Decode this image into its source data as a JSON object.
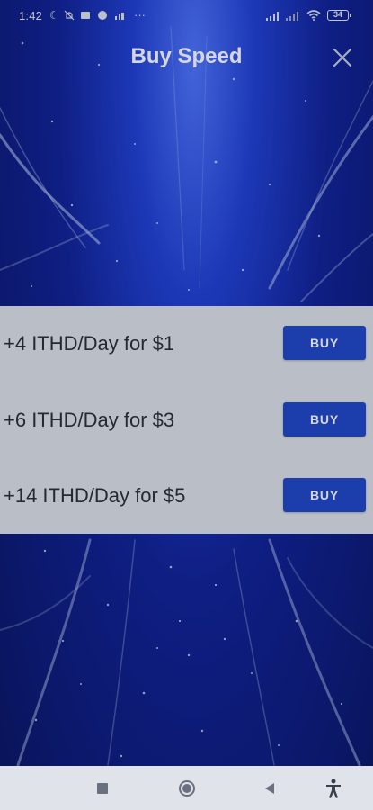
{
  "status_bar": {
    "time": "1:42",
    "more_dots": "···",
    "battery": "34",
    "icons": [
      "moon-icon",
      "mute-icon",
      "notification-icon",
      "app-icon",
      "network-icon",
      "signal-icon",
      "wifi-icon",
      "battery-icon"
    ]
  },
  "header": {
    "title": "Buy Speed",
    "close_icon": "close-icon"
  },
  "offers": [
    {
      "label": "+4 ITHD/Day for $1",
      "button": "BUY"
    },
    {
      "label": "+6 ITHD/Day for $3",
      "button": "BUY"
    },
    {
      "label": "+14 ITHD/Day for $5",
      "button": "BUY"
    }
  ],
  "nav_bar": {
    "icons": [
      "recents-icon",
      "home-icon",
      "back-icon",
      "accessibility-icon"
    ]
  },
  "colors": {
    "accent": "#1e46c8",
    "panel": "#dfe3ea",
    "background": "#1230b8"
  }
}
